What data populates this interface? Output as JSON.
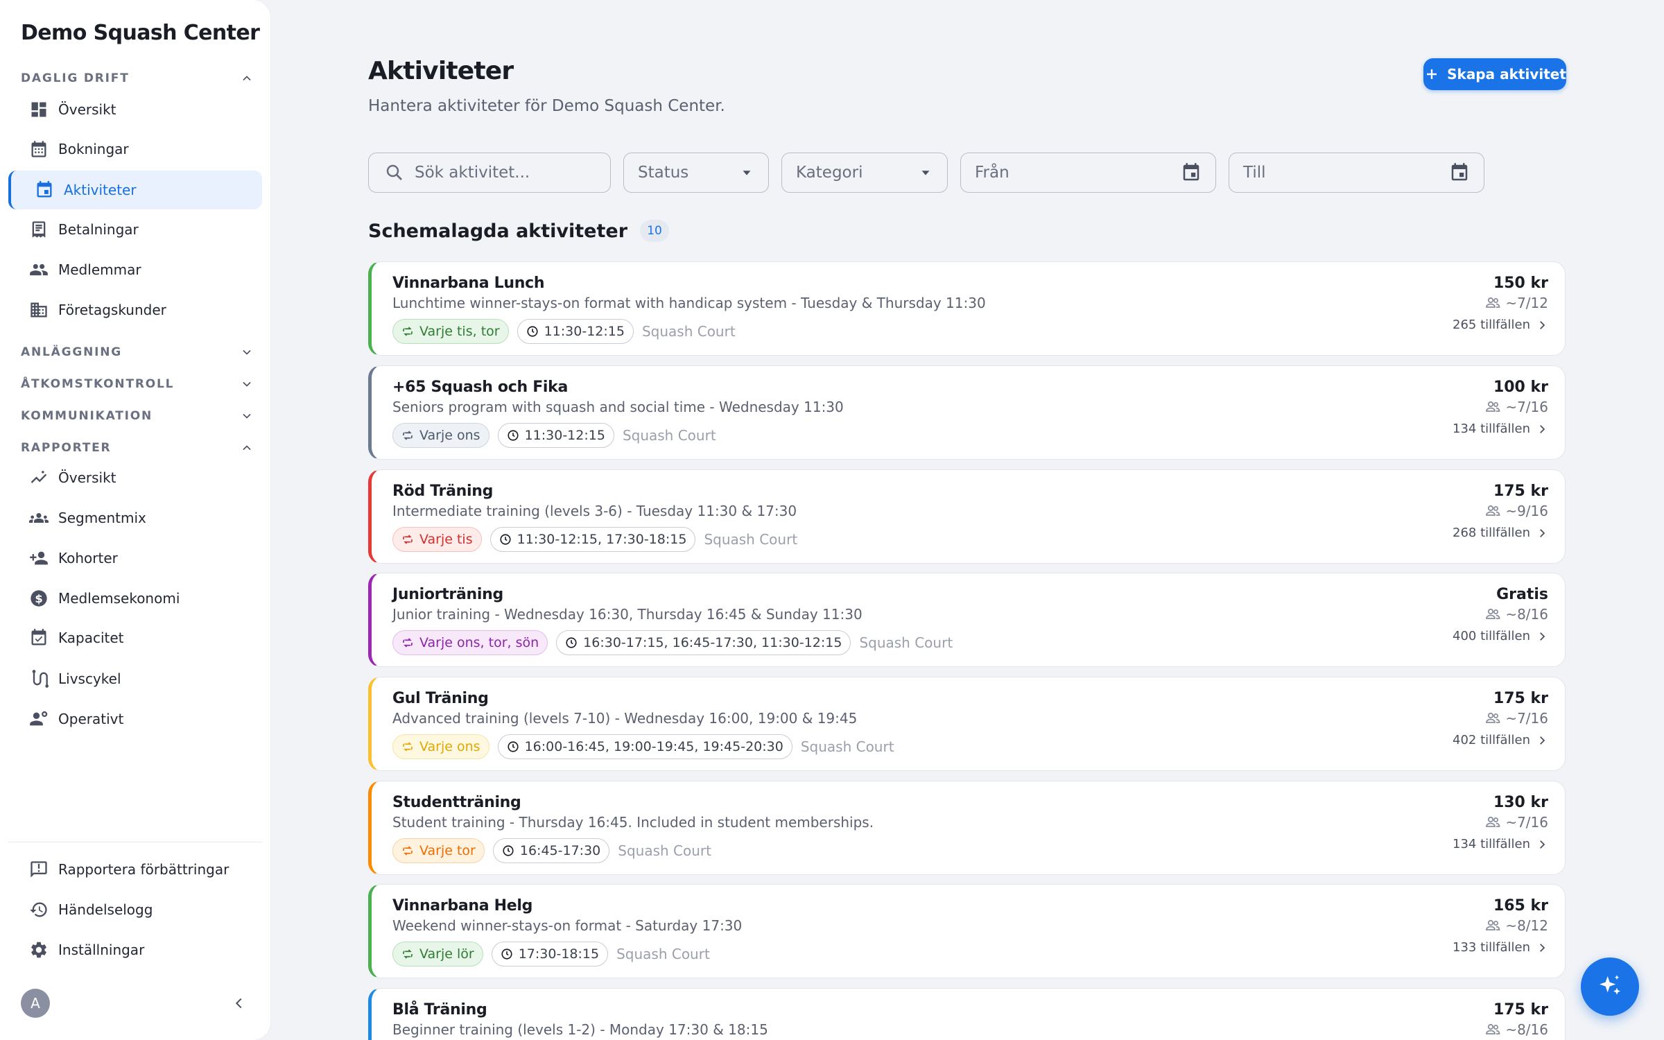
{
  "app": {
    "brand": "Demo Squash Center"
  },
  "sidebar": {
    "sections": {
      "daily": "DAGLIG DRIFT",
      "facility": "ANLÄGGNING",
      "access": "ÅTKOMSTKONTROLL",
      "communication": "KOMMUNIKATION",
      "reports": "RAPPORTER"
    },
    "daily_items": [
      "Översikt",
      "Bokningar",
      "Aktiviteter",
      "Betalningar",
      "Medlemmar",
      "Företagskunder"
    ],
    "report_items": [
      "Översikt",
      "Segmentmix",
      "Kohorter",
      "Medlemsekonomi",
      "Kapacitet",
      "Livscykel",
      "Operativt"
    ],
    "bottom_items": [
      "Rapportera förbättringar",
      "Händelselogg",
      "Inställningar"
    ],
    "avatar_initial": "A"
  },
  "page": {
    "title": "Aktiviteter",
    "subtitle": "Hantera aktiviteter för Demo Squash Center.",
    "create_label": "Skapa aktivitet"
  },
  "filters": {
    "search_placeholder": "Sök aktivitet...",
    "status_label": "Status",
    "category_label": "Kategori",
    "from_label": "Från",
    "to_label": "Till"
  },
  "scheduled": {
    "heading": "Schemalagda aktiviteter",
    "count": "10"
  },
  "colors": {
    "accent": "#1b73e8",
    "green": "#4caf50",
    "slate": "#6b7a90",
    "red": "#e53935",
    "purple": "#9c27b0",
    "yellow": "#fbc02d",
    "orange": "#fb8c00",
    "blue": "#1e88e5"
  },
  "activities": [
    {
      "name": "Vinnarbana Lunch",
      "desc": "Lunchtime winner-stays-on format with handicap system - Tuesday & Thursday 11:30",
      "recurrence": "Varje tis, tor",
      "time": "11:30-12:15",
      "court": "Squash Court",
      "price": "150 kr",
      "capacity": "~7/12",
      "occurrences": "265 tillfällen",
      "color": "green"
    },
    {
      "name": "+65 Squash och Fika",
      "desc": "Seniors program with squash and social time - Wednesday 11:30",
      "recurrence": "Varje ons",
      "time": "11:30-12:15",
      "court": "Squash Court",
      "price": "100 kr",
      "capacity": "~7/16",
      "occurrences": "134 tillfällen",
      "color": "slate"
    },
    {
      "name": "Röd Träning",
      "desc": "Intermediate training (levels 3-6) - Tuesday 11:30 & 17:30",
      "recurrence": "Varje tis",
      "time": "11:30-12:15, 17:30-18:15",
      "court": "Squash Court",
      "price": "175 kr",
      "capacity": "~9/16",
      "occurrences": "268 tillfällen",
      "color": "red"
    },
    {
      "name": "Juniorträning",
      "desc": "Junior training - Wednesday 16:30, Thursday 16:45 & Sunday 11:30",
      "recurrence": "Varje ons, tor, sön",
      "time": "16:30-17:15, 16:45-17:30, 11:30-12:15",
      "court": "Squash Court",
      "price": "Gratis",
      "capacity": "~8/16",
      "occurrences": "400 tillfällen",
      "color": "purple"
    },
    {
      "name": "Gul Träning",
      "desc": "Advanced training (levels 7-10) - Wednesday 16:00, 19:00 & 19:45",
      "recurrence": "Varje ons",
      "time": "16:00-16:45, 19:00-19:45, 19:45-20:30",
      "court": "Squash Court",
      "price": "175 kr",
      "capacity": "~7/16",
      "occurrences": "402 tillfällen",
      "color": "yellow"
    },
    {
      "name": "Studentträning",
      "desc": "Student training - Thursday 16:45. Included in student memberships.",
      "recurrence": "Varje tor",
      "time": "16:45-17:30",
      "court": "Squash Court",
      "price": "130 kr",
      "capacity": "~7/16",
      "occurrences": "134 tillfällen",
      "color": "orange"
    },
    {
      "name": "Vinnarbana Helg",
      "desc": "Weekend winner-stays-on format - Saturday 17:30",
      "recurrence": "Varje lör",
      "time": "17:30-18:15",
      "court": "Squash Court",
      "price": "165 kr",
      "capacity": "~8/12",
      "occurrences": "133 tillfällen",
      "color": "green"
    },
    {
      "name": "Blå Träning",
      "desc": "Beginner training (levels 1-2) - Monday 17:30 & 18:15",
      "recurrence": "",
      "time": "",
      "court": "",
      "price": "175 kr",
      "capacity": "~8/16",
      "occurrences": "",
      "color": "blue"
    }
  ]
}
